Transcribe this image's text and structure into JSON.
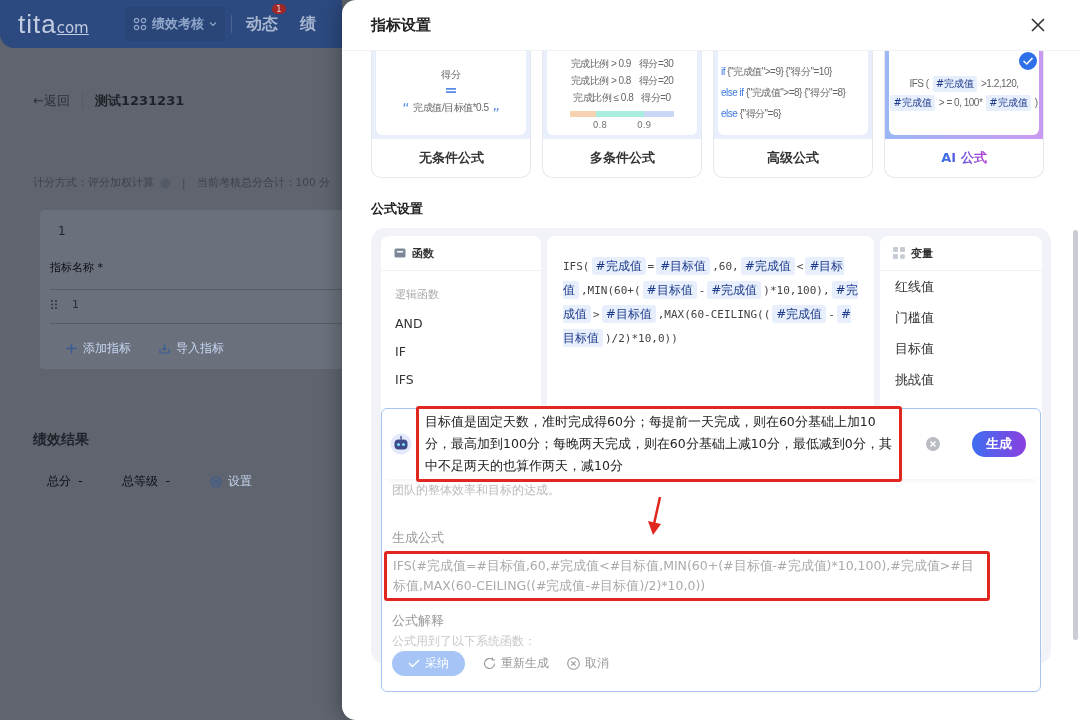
{
  "app_header": {
    "logo": "tita",
    "logo_suffix": "com",
    "nav": [
      {
        "kind": "dropdown",
        "label": "绩效考核"
      },
      {
        "kind": "link",
        "label": "动态",
        "badge": "1"
      },
      {
        "kind": "link",
        "label": "绩"
      }
    ]
  },
  "page": {
    "back": "←返回",
    "title": "测试1231231",
    "scoring": "计分方式：评分加权计算",
    "separator": "|",
    "total": "当前考核总分合计：100 分",
    "group_number": "1",
    "column_header": "指标名称 *",
    "row_number": "1",
    "actions": [
      {
        "kind": "add",
        "label": "添加指标"
      },
      {
        "kind": "import",
        "label": "导入指标"
      }
    ],
    "results_title": "绩效结果",
    "results": [
      {
        "label": "总分",
        "value": "-"
      },
      {
        "label": "总等级",
        "value": "-"
      }
    ],
    "settings_link": "设置"
  },
  "dialog": {
    "title": "指标设置",
    "templates": [
      {
        "kind": "plain",
        "label": "无条件公式",
        "selected": false,
        "top": "得分",
        "equals": "=",
        "formula": "完成值/目标值*0.5",
        "open_quote": "“",
        "close_quote": "”"
      },
      {
        "kind": "conditions",
        "label": "多条件公式",
        "selected": false,
        "lines": [
          {
            "condition": "完成比例 > 0.9",
            "score": "得分=30"
          },
          {
            "condition": "完成比例 > 0.8",
            "score": "得分=20"
          },
          {
            "condition": "完成比例 ≤ 0.8",
            "score": "得分=0"
          }
        ],
        "ticks": [
          "0.8",
          "0.9"
        ]
      },
      {
        "kind": "advanced",
        "label": "高级公式",
        "selected": false,
        "lines": [
          {
            "keyword": "if",
            "code": "{\"完成值\">=9} {\"得分\"=10}"
          },
          {
            "keyword": "else if",
            "code": "{\"完成值\">=8} {\"得分\"=8}"
          },
          {
            "keyword": "else",
            "code": "{\"得分\"=6}"
          }
        ]
      },
      {
        "kind": "ai",
        "label": "AI 公式",
        "selected": true,
        "segments": [
          {
            "kind": "text",
            "text": "IFS ("
          },
          {
            "kind": "var",
            "text": "#完成值"
          },
          {
            "kind": "text",
            "text": ">1.2,120,"
          },
          {
            "kind": "var",
            "text": "#完成值"
          },
          {
            "kind": "text",
            "text": "> = 0, 100*"
          },
          {
            "kind": "var",
            "text": "#完成值"
          },
          {
            "kind": "text",
            "text": ")"
          }
        ]
      }
    ],
    "section_title": "公式设置",
    "functions": {
      "title": "函数",
      "category": "逻辑函数",
      "items": [
        "AND",
        "IF",
        "IFS"
      ]
    },
    "formula": [
      {
        "kind": "text",
        "text": "IFS("
      },
      {
        "kind": "var",
        "text": "#完成值"
      },
      {
        "kind": "text",
        "text": "="
      },
      {
        "kind": "var",
        "text": "#目标值"
      },
      {
        "kind": "text",
        "text": ",60,"
      },
      {
        "kind": "var",
        "text": "#完成值"
      },
      {
        "kind": "text",
        "text": "<"
      },
      {
        "kind": "var",
        "text": "#目标值"
      },
      {
        "kind": "text",
        "text": ",MIN(60+("
      },
      {
        "kind": "var",
        "text": "#目标值"
      },
      {
        "kind": "text",
        "text": "-"
      },
      {
        "kind": "var",
        "text": "#完成值"
      },
      {
        "kind": "text",
        "text": ")*10,100),"
      },
      {
        "kind": "var",
        "text": "#完成值"
      },
      {
        "kind": "text",
        "text": ">"
      },
      {
        "kind": "var",
        "text": "#目标值"
      },
      {
        "kind": "text",
        "text": ",MAX(60-CEILING(("
      },
      {
        "kind": "var",
        "text": "#完成值"
      },
      {
        "kind": "text",
        "text": "-"
      },
      {
        "kind": "var",
        "text": "#目标值"
      },
      {
        "kind": "text",
        "text": ")/2)*10,0))"
      }
    ],
    "variables": {
      "title": "变量",
      "items": [
        "红线值",
        "门槛值",
        "目标值",
        "挑战值"
      ]
    }
  },
  "ai_panel": {
    "prompt": "目标值是固定天数，准时完成得60分；每提前一天完成，则在60分基础上加10分，最高加到100分；每晚两天完成，则在60分基础上减10分，最低减到0分，其中不足两天的也算作两天，减10分",
    "prompt_annotated": true,
    "generate": "生成",
    "context_text": "团队的整体效率和目标的达成。",
    "result_label": "生成公式",
    "result": "IFS(#完成值=#目标值,60,#完成值<#目标值,MIN(60+(#目标值-#完成值)*10,100),#完成值>#目标值,MAX(60-CEILING((#完成值-#目标值)/2)*10,0))",
    "result_annotated": true,
    "explain_label": "公式解释",
    "explain_text": "公式用到了以下系统函数：",
    "actions": [
      {
        "kind": "accept",
        "label": "采纳"
      },
      {
        "kind": "regenerate",
        "label": "重新生成"
      },
      {
        "kind": "cancel",
        "label": "取消"
      }
    ]
  }
}
